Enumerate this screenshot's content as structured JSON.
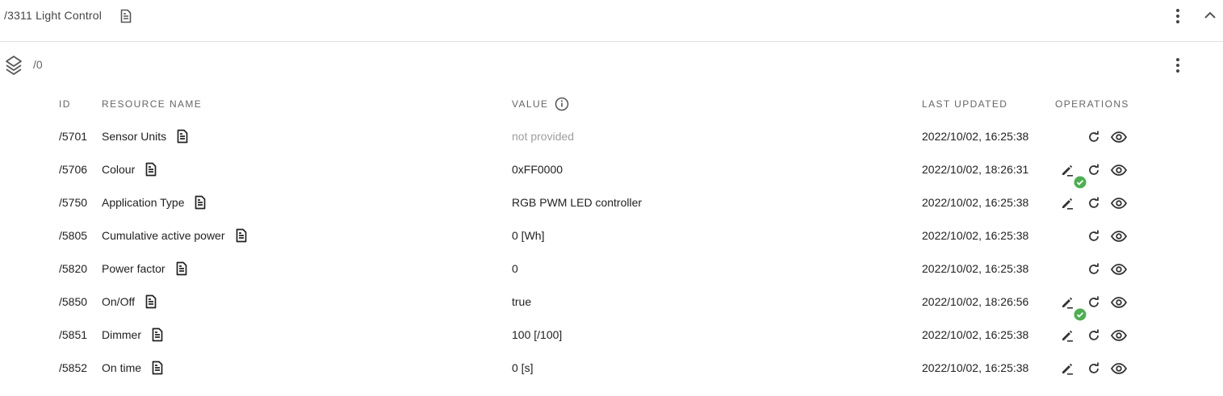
{
  "object": {
    "title": "/3311 Light Control",
    "instance": "/0"
  },
  "columns": {
    "id": "ID",
    "name": "RESOURCE NAME",
    "value": "VALUE",
    "updated": "LAST UPDATED",
    "operations": "OPERATIONS"
  },
  "rows": [
    {
      "id": "/5701",
      "name": "Sensor Units",
      "value": "not provided",
      "updated": "2022/10/02, 16:25:38",
      "write": false,
      "success": false,
      "muted": true
    },
    {
      "id": "/5706",
      "name": "Colour",
      "value": "0xFF0000",
      "updated": "2022/10/02, 18:26:31",
      "write": true,
      "success": true,
      "muted": false
    },
    {
      "id": "/5750",
      "name": "Application Type",
      "value": "RGB PWM LED controller",
      "updated": "2022/10/02, 16:25:38",
      "write": true,
      "success": false,
      "muted": false
    },
    {
      "id": "/5805",
      "name": "Cumulative active power",
      "value": "0 [Wh]",
      "updated": "2022/10/02, 16:25:38",
      "write": false,
      "success": false,
      "muted": false
    },
    {
      "id": "/5820",
      "name": "Power factor",
      "value": "0",
      "updated": "2022/10/02, 16:25:38",
      "write": false,
      "success": false,
      "muted": false
    },
    {
      "id": "/5850",
      "name": "On/Off",
      "value": "true",
      "updated": "2022/10/02, 18:26:56",
      "write": true,
      "success": true,
      "muted": false
    },
    {
      "id": "/5851",
      "name": "Dimmer",
      "value": "100 [/100]",
      "updated": "2022/10/02, 16:25:38",
      "write": true,
      "success": false,
      "muted": false
    },
    {
      "id": "/5852",
      "name": "On time",
      "value": "0 [s]",
      "updated": "2022/10/02, 16:25:38",
      "write": true,
      "success": false,
      "muted": false
    }
  ],
  "colors": {
    "success": "#4caf50",
    "text": "#212121",
    "muted": "#9e9e9e"
  },
  "icons": {
    "doc": "description-icon",
    "layers": "layers-icon",
    "more": "more-vert-icon",
    "collapse": "chevron-up-icon",
    "write": "edit-icon",
    "read": "refresh-icon",
    "observe": "eye-icon"
  }
}
